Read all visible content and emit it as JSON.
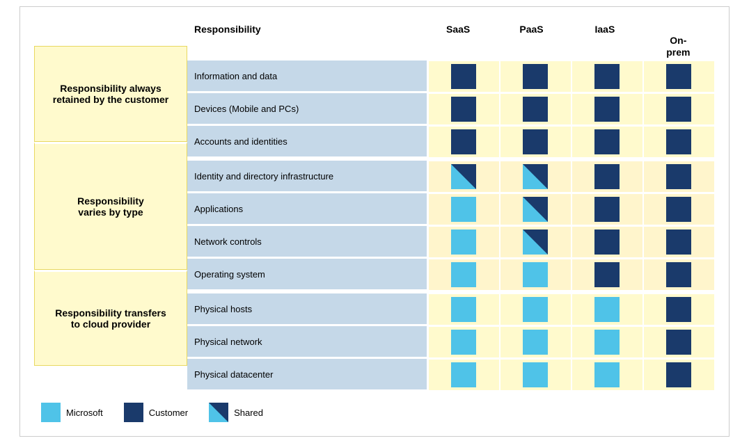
{
  "header": {
    "responsibility_label": "Responsibility",
    "columns": [
      "SaaS",
      "PaaS",
      "IaaS",
      "On-\nprem"
    ]
  },
  "left_labels": [
    {
      "id": "always",
      "text": "Responsibility always\nretained by the customer",
      "rows": 3
    },
    {
      "id": "varies",
      "text": "Responsibility\nvaries by type",
      "rows": 4
    },
    {
      "id": "transfers",
      "text": "Responsibility transfers\nto cloud provider",
      "rows": 3
    }
  ],
  "rows": [
    {
      "label": "Information and data",
      "saas": "customer",
      "paas": "customer",
      "iaas": "customer",
      "onprem": "customer",
      "section": "top"
    },
    {
      "label": "Devices (Mobile and PCs)",
      "saas": "customer",
      "paas": "customer",
      "iaas": "customer",
      "onprem": "customer",
      "section": "top"
    },
    {
      "label": "Accounts and identities",
      "saas": "customer",
      "paas": "customer",
      "iaas": "customer",
      "onprem": "customer",
      "section": "top"
    },
    {
      "label": "Identity and directory infrastructure",
      "saas": "shared",
      "paas": "shared",
      "iaas": "customer",
      "onprem": "customer",
      "section": "mid"
    },
    {
      "label": "Applications",
      "saas": "microsoft",
      "paas": "shared",
      "iaas": "customer",
      "onprem": "customer",
      "section": "mid"
    },
    {
      "label": "Network controls",
      "saas": "microsoft",
      "paas": "shared",
      "iaas": "customer",
      "onprem": "customer",
      "section": "mid"
    },
    {
      "label": "Operating system",
      "saas": "microsoft",
      "paas": "microsoft",
      "iaas": "customer",
      "onprem": "customer",
      "section": "mid"
    },
    {
      "label": "Physical hosts",
      "saas": "microsoft",
      "paas": "microsoft",
      "iaas": "microsoft",
      "onprem": "customer",
      "section": "bot"
    },
    {
      "label": "Physical network",
      "saas": "microsoft",
      "paas": "microsoft",
      "iaas": "microsoft",
      "onprem": "customer",
      "section": "bot"
    },
    {
      "label": "Physical datacenter",
      "saas": "microsoft",
      "paas": "microsoft",
      "iaas": "microsoft",
      "onprem": "customer",
      "section": "bot"
    }
  ],
  "legend": {
    "items": [
      {
        "type": "microsoft",
        "label": "Microsoft"
      },
      {
        "type": "customer",
        "label": "Customer"
      },
      {
        "type": "shared",
        "label": "Shared"
      }
    ]
  }
}
